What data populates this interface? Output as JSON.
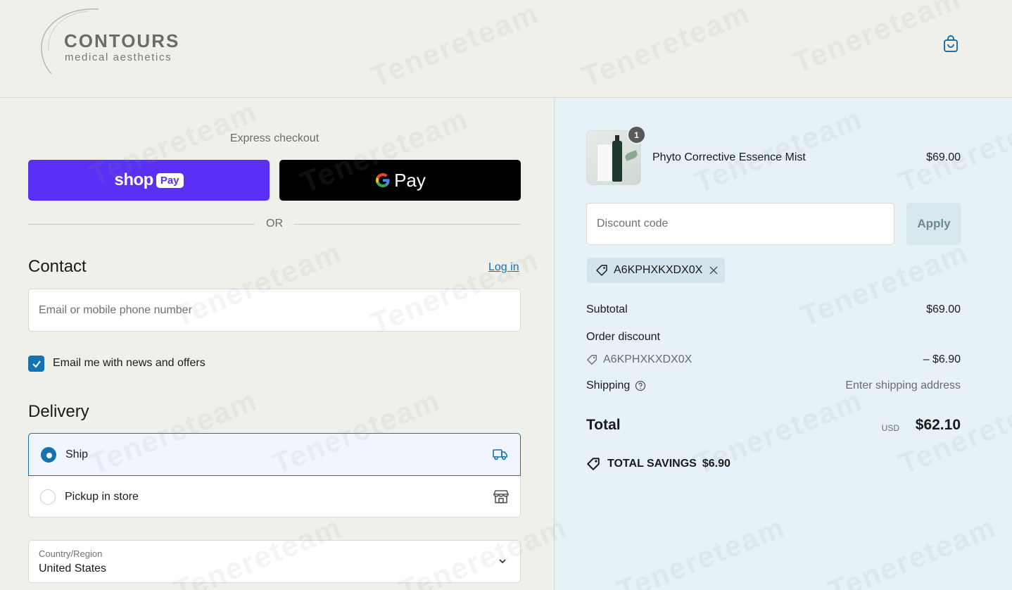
{
  "brand": {
    "name": "CONTOURS",
    "tagline": "medical aesthetics"
  },
  "header": {
    "cart_icon": "shopping-bag-icon"
  },
  "express": {
    "title": "Express checkout",
    "shop_pay_word": "shop",
    "shop_pay_pill": "Pay",
    "gpay_word": "Pay",
    "or_text": "OR",
    "shop_pay_color": "#5a31f4",
    "gpay_color": "#000000"
  },
  "contact": {
    "title": "Contact",
    "login_label": "Log in",
    "email_placeholder": "Email or mobile phone number",
    "email_value": "",
    "newsletter_label": "Email me with news and offers",
    "newsletter_checked": true
  },
  "delivery": {
    "title": "Delivery",
    "options": [
      {
        "label": "Ship",
        "selected": true,
        "icon": "truck-icon"
      },
      {
        "label": "Pickup in store",
        "selected": false,
        "icon": "store-icon"
      }
    ],
    "country_label": "Country/Region",
    "country_value": "United States"
  },
  "order": {
    "item": {
      "name": "Phyto Corrective Essence Mist",
      "price": "$69.00",
      "quantity": "1"
    },
    "discount_placeholder": "Discount code",
    "apply_label": "Apply",
    "applied_code": "A6KPHXKXDX0X",
    "subtotal_label": "Subtotal",
    "subtotal_value": "$69.00",
    "order_discount_label": "Order discount",
    "discount_code": "A6KPHXKXDX0X",
    "discount_value": "– $6.90",
    "shipping_label": "Shipping",
    "shipping_value": "Enter shipping address",
    "total_label": "Total",
    "total_currency": "USD",
    "total_value": "$62.10",
    "savings_label": "TOTAL SAVINGS",
    "savings_value": "$6.90"
  },
  "colors": {
    "accent": "#1773b0",
    "summary_bg": "#e6f2f8",
    "page_bg": "#f0f0ea"
  },
  "watermark": "Tenereteam"
}
